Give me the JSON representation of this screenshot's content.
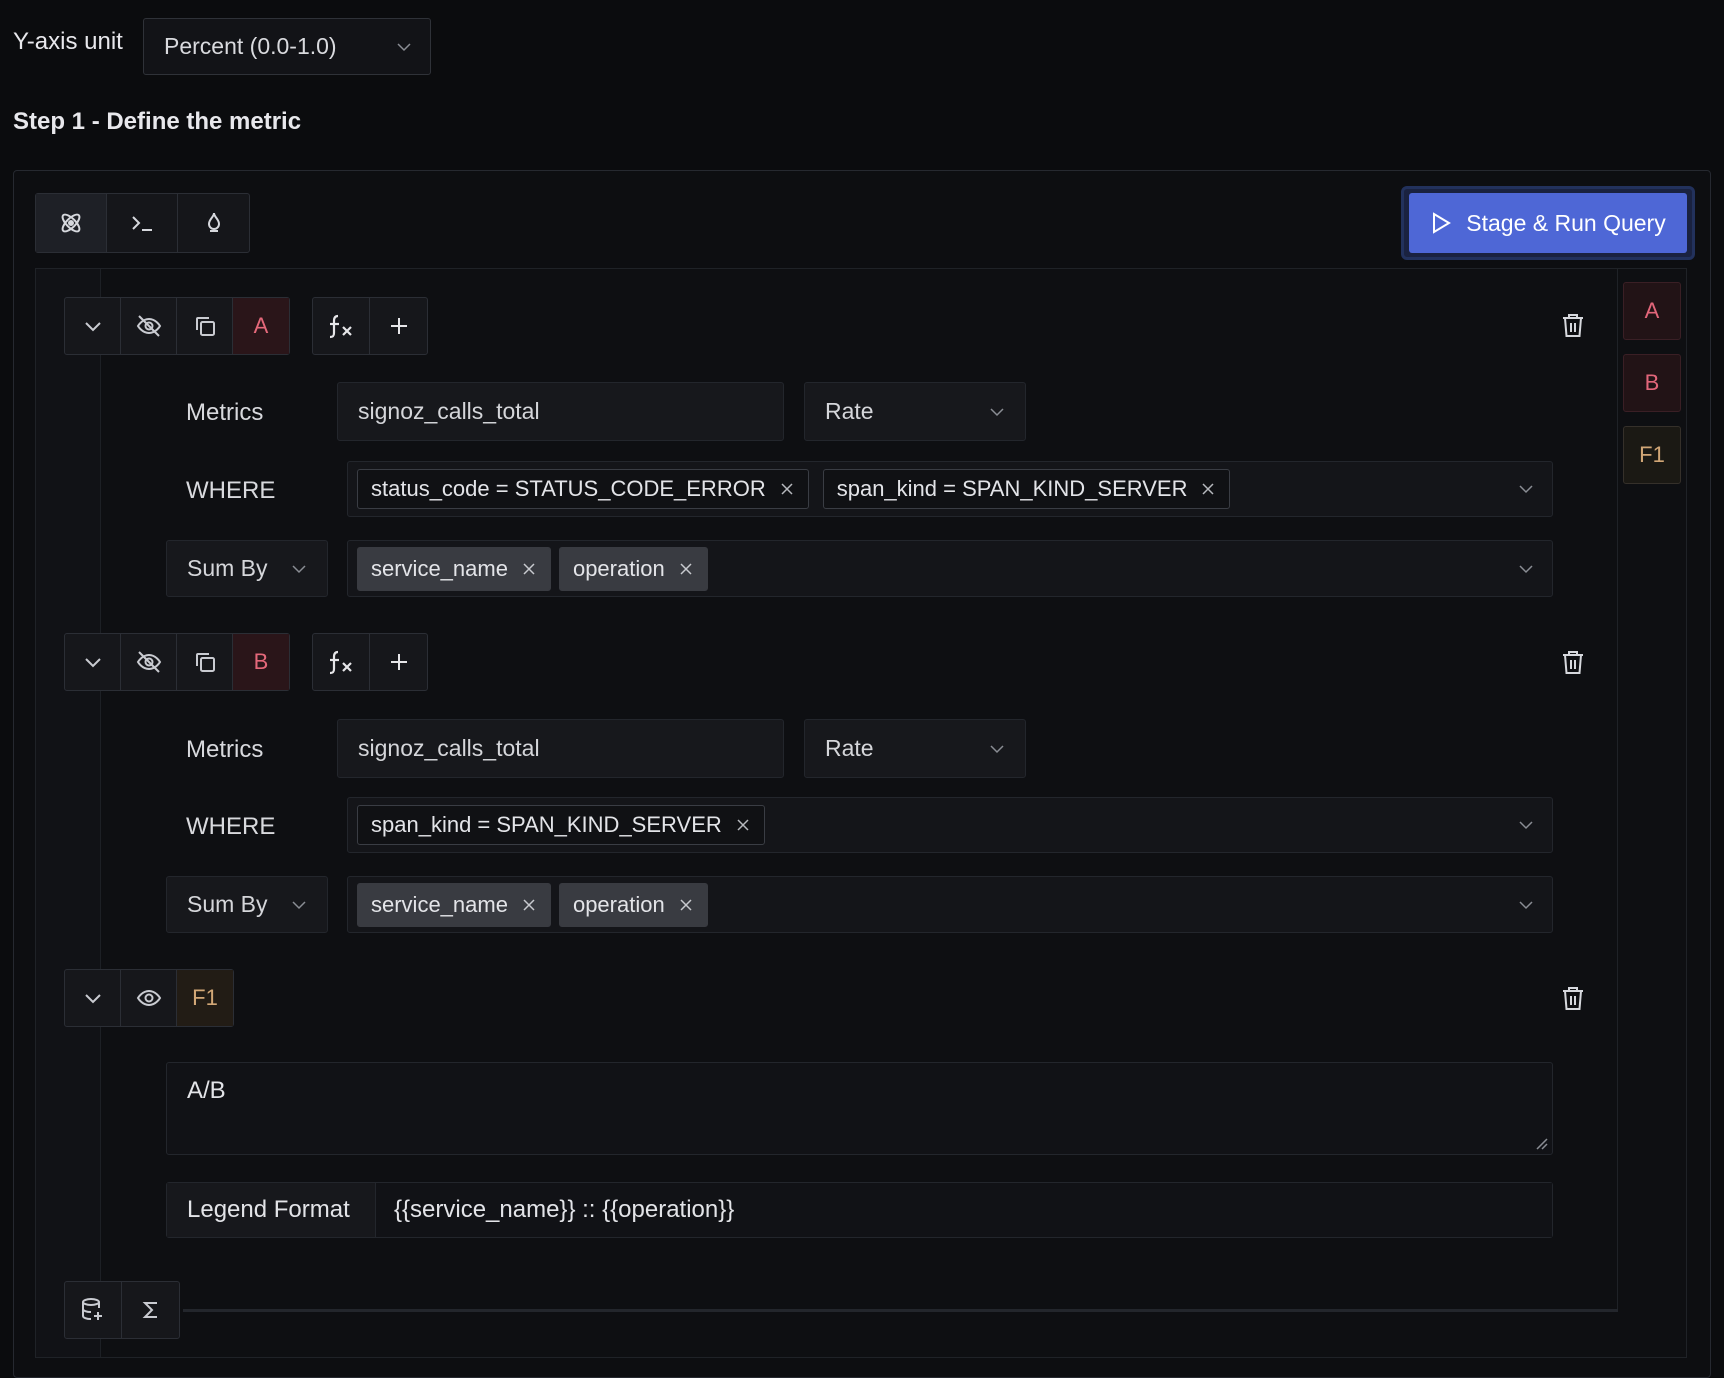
{
  "y_axis": {
    "label": "Y-axis unit",
    "selected": "Percent (0.0-1.0)"
  },
  "step_title": "Step 1 - Define the metric",
  "run_button": {
    "label": "Stage & Run Query"
  },
  "queries": [
    {
      "letter": "A",
      "metrics_label": "Metrics",
      "metric": "signoz_calls_total",
      "aggregation": "Rate",
      "where_label": "WHERE",
      "where_tags": [
        "status_code = STATUS_CODE_ERROR",
        "span_kind = SPAN_KIND_SERVER"
      ],
      "group_by_label": "Sum By",
      "group_tags": [
        "service_name",
        "operation"
      ]
    },
    {
      "letter": "B",
      "metrics_label": "Metrics",
      "metric": "signoz_calls_total",
      "aggregation": "Rate",
      "where_label": "WHERE",
      "where_tags": [
        "span_kind = SPAN_KIND_SERVER"
      ],
      "group_by_label": "Sum By",
      "group_tags": [
        "service_name",
        "operation"
      ]
    }
  ],
  "formula": {
    "letter": "F1",
    "expression": "A/B",
    "legend_label": "Legend Format",
    "legend_value": "{{service_name}} :: {{operation}}"
  },
  "side_tabs": [
    "A",
    "B",
    "F1"
  ],
  "colors": {
    "accent": "#4e67d6",
    "query_letter": "#e4687a",
    "formula_letter": "#d3a877",
    "background": "#0b0c0e"
  }
}
